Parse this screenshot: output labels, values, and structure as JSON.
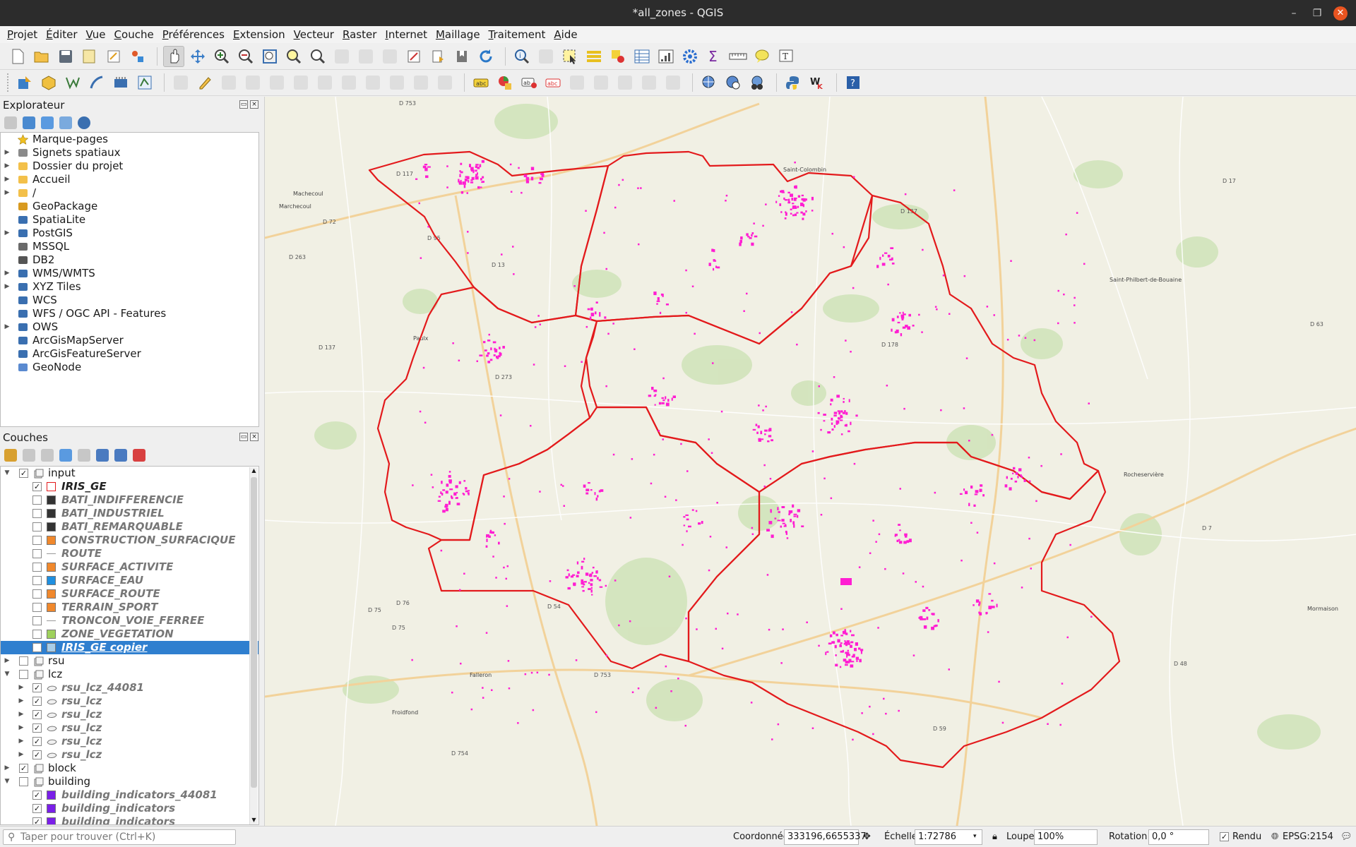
{
  "window": {
    "title": "*all_zones - QGIS",
    "minimize": "–",
    "restore": "❐",
    "close": "✕"
  },
  "menu": [
    "Projet",
    "Éditer",
    "Vue",
    "Couche",
    "Préférences",
    "Extension",
    "Vecteur",
    "Raster",
    "Internet",
    "Maillage",
    "Traitement",
    "Aide"
  ],
  "explorer": {
    "title": "Explorateur",
    "items": [
      {
        "label": "Marque-pages",
        "icon": "star-icon",
        "expand": false
      },
      {
        "label": "Signets spatiaux",
        "icon": "spatial-bookmark-icon",
        "expand": true
      },
      {
        "label": "Dossier du projet",
        "icon": "folder-icon",
        "expand": true
      },
      {
        "label": "Accueil",
        "icon": "folder-icon",
        "expand": true
      },
      {
        "label": "/",
        "icon": "folder-icon",
        "expand": true
      },
      {
        "label": "GeoPackage",
        "icon": "geopackage-icon",
        "expand": false
      },
      {
        "label": "SpatiaLite",
        "icon": "spatialite-icon",
        "expand": false
      },
      {
        "label": "PostGIS",
        "icon": "postgis-icon",
        "expand": true
      },
      {
        "label": "MSSQL",
        "icon": "mssql-icon",
        "expand": false
      },
      {
        "label": "DB2",
        "icon": "db2-icon",
        "expand": false
      },
      {
        "label": "WMS/WMTS",
        "icon": "globe-icon",
        "expand": true
      },
      {
        "label": "XYZ Tiles",
        "icon": "globe-icon",
        "expand": true
      },
      {
        "label": "WCS",
        "icon": "globe-icon",
        "expand": false
      },
      {
        "label": "WFS / OGC API - Features",
        "icon": "wfs-icon",
        "expand": false
      },
      {
        "label": "OWS",
        "icon": "globe-icon",
        "expand": true
      },
      {
        "label": "ArcGisMapServer",
        "icon": "arcgis-icon",
        "expand": false
      },
      {
        "label": "ArcGisFeatureServer",
        "icon": "arcgis-icon",
        "expand": false
      },
      {
        "label": "GeoNode",
        "icon": "geonode-icon",
        "expand": false
      }
    ]
  },
  "layers": {
    "title": "Couches",
    "items": [
      {
        "label": "input",
        "kind": "group",
        "indent": 0,
        "checked": true,
        "expand": "open"
      },
      {
        "label": "IRIS_GE",
        "kind": "layer",
        "indent": 1,
        "checked": true,
        "swatch": "outline-red",
        "on": true
      },
      {
        "label": "BATI_INDIFFERENCIE",
        "kind": "layer",
        "indent": 1,
        "checked": false,
        "swatch": "#333333"
      },
      {
        "label": "BATI_INDUSTRIEL",
        "kind": "layer",
        "indent": 1,
        "checked": false,
        "swatch": "#333333"
      },
      {
        "label": "BATI_REMARQUABLE",
        "kind": "layer",
        "indent": 1,
        "checked": false,
        "swatch": "#333333"
      },
      {
        "label": "CONSTRUCTION_SURFACIQUE",
        "kind": "layer",
        "indent": 1,
        "checked": false,
        "swatch": "#f0882c"
      },
      {
        "label": "ROUTE",
        "kind": "layer",
        "indent": 1,
        "checked": false,
        "swatch": "line"
      },
      {
        "label": "SURFACE_ACTIVITE",
        "kind": "layer",
        "indent": 1,
        "checked": false,
        "swatch": "#f0882c"
      },
      {
        "label": "SURFACE_EAU",
        "kind": "layer",
        "indent": 1,
        "checked": false,
        "swatch": "#1f8fe0"
      },
      {
        "label": "SURFACE_ROUTE",
        "kind": "layer",
        "indent": 1,
        "checked": false,
        "swatch": "#f0882c"
      },
      {
        "label": "TERRAIN_SPORT",
        "kind": "layer",
        "indent": 1,
        "checked": false,
        "swatch": "#f0882c"
      },
      {
        "label": "TRONCON_VOIE_FERREE",
        "kind": "layer",
        "indent": 1,
        "checked": false,
        "swatch": "line"
      },
      {
        "label": "ZONE_VEGETATION",
        "kind": "layer",
        "indent": 1,
        "checked": false,
        "swatch": "#9fd15c"
      },
      {
        "label": "IRIS_GE copier",
        "kind": "layer",
        "indent": 1,
        "checked": false,
        "swatch": "#a8cde8",
        "selected": true
      },
      {
        "label": "rsu",
        "kind": "group",
        "indent": 0,
        "checked": false,
        "expand": "closed"
      },
      {
        "label": "lcz",
        "kind": "group",
        "indent": 0,
        "checked": false,
        "expand": "open"
      },
      {
        "label": "rsu_lcz_44081",
        "kind": "layer",
        "indent": 1,
        "checked": true,
        "swatch": "vector",
        "expand": "closed"
      },
      {
        "label": "rsu_lcz",
        "kind": "layer",
        "indent": 1,
        "checked": true,
        "swatch": "vector",
        "expand": "closed"
      },
      {
        "label": "rsu_lcz",
        "kind": "layer",
        "indent": 1,
        "checked": true,
        "swatch": "vector",
        "expand": "closed"
      },
      {
        "label": "rsu_lcz",
        "kind": "layer",
        "indent": 1,
        "checked": true,
        "swatch": "vector",
        "expand": "closed"
      },
      {
        "label": "rsu_lcz",
        "kind": "layer",
        "indent": 1,
        "checked": true,
        "swatch": "vector",
        "expand": "closed"
      },
      {
        "label": "rsu_lcz",
        "kind": "layer",
        "indent": 1,
        "checked": true,
        "swatch": "vector",
        "expand": "closed"
      },
      {
        "label": "block",
        "kind": "group",
        "indent": 0,
        "checked": true,
        "expand": "closed"
      },
      {
        "label": "building",
        "kind": "group",
        "indent": 0,
        "checked": false,
        "expand": "open"
      },
      {
        "label": "building_indicators_44081",
        "kind": "layer",
        "indent": 1,
        "checked": true,
        "swatch": "#7a1fe8"
      },
      {
        "label": "building_indicators",
        "kind": "layer",
        "indent": 1,
        "checked": true,
        "swatch": "#7a1fe8"
      },
      {
        "label": "building_indicators",
        "kind": "layer",
        "indent": 1,
        "checked": true,
        "swatch": "#7a1fe8"
      }
    ]
  },
  "status": {
    "search_placeholder": "Taper pour trouver (Ctrl+K)",
    "coord_label": "Coordonnée",
    "coord_value": "333196,6655337",
    "scale_label": "Échelle",
    "scale_value": "1:72786",
    "magnifier_label": "Loupe",
    "magnifier_value": "100%",
    "rotation_label": "Rotation",
    "rotation_value": "0,0 °",
    "render_label": "Rendu",
    "crs": "EPSG:2154"
  },
  "map": {
    "town_labels": [
      "Marchecoul",
      "Saint-Colombin",
      "Saint-Philbert-de-Bouaine",
      "Machecoul",
      "Paulx",
      "Falleron",
      "Rocheservière",
      "Froidfond",
      "Mormaison"
    ],
    "road_labels": [
      "D 117",
      "D 72",
      "D 95",
      "D 263",
      "D 13",
      "D 273",
      "D 137",
      "D 753",
      "D 178",
      "D 76",
      "D 75",
      "D 754",
      "D 59",
      "D 48",
      "D 7",
      "D 137",
      "D 17",
      "D 63",
      "D 54",
      "D 753",
      "D 75"
    ]
  }
}
